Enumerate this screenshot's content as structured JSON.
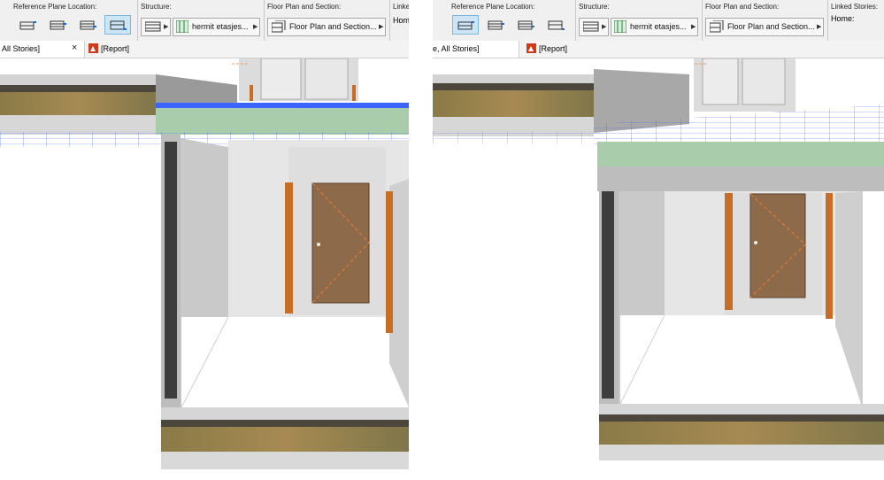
{
  "left": {
    "toolbar": {
      "reference_plane_label": "Reference Plane Location:",
      "structure_label": "Structure:",
      "structure_value": "hermit etasjes...",
      "floorplan_label": "Floor Plan and Section:",
      "floorplan_value": "Floor Plan and Section...",
      "linked_label": "Linke",
      "linked_value": "Hom"
    },
    "tabs": [
      {
        "label": "All Stories]",
        "close": "×"
      },
      {
        "label": "[Report]"
      }
    ]
  },
  "right": {
    "toolbar": {
      "reference_plane_label": "Reference Plane Location:",
      "structure_label": "Structure:",
      "structure_value": "hermit etasjes...",
      "floorplan_label": "Floor Plan and Section:",
      "floorplan_value": "Floor Plan and Section...",
      "linked_label": "Linked Stories:",
      "linked_value": "Home:"
    },
    "tabs": [
      {
        "label": "e, All Stories]"
      },
      {
        "label": "[Report]"
      }
    ]
  },
  "icons": {
    "ref_plane_buttons": [
      "plane-top-icon",
      "plane-core-top-icon",
      "plane-core-bottom-icon",
      "plane-bottom-icon"
    ],
    "structure_icon": "composite-structure-icon",
    "floorplan_icon": "floor-plan-section-icon",
    "report_icon": "report-icon"
  },
  "colors": {
    "toolbar_bg": "#f0f0f0",
    "active_button": "#cde6f7",
    "slab": "#a9ccaa",
    "door": "#8c6a4a",
    "door_frame": "#c76d26",
    "grid": "#3a66ff",
    "report_icon": "#d03a1b"
  },
  "state": {
    "left_active_ref_plane_button": 4,
    "right_active_ref_plane_button": 1
  }
}
